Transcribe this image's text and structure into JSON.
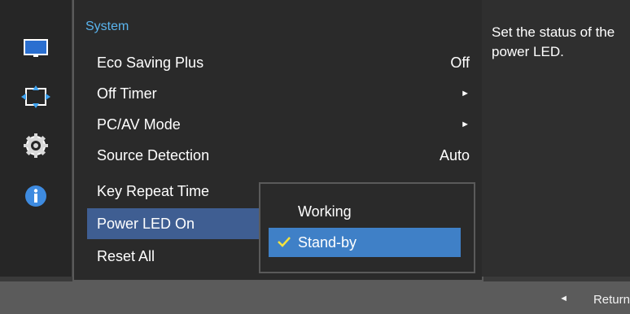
{
  "sidebar": {
    "icons": [
      "monitor-icon",
      "resize-arrows-icon",
      "gear-icon",
      "info-icon"
    ]
  },
  "menu": {
    "title": "System",
    "items": [
      {
        "label": "Eco Saving Plus",
        "value": "Off"
      },
      {
        "label": "Off Timer",
        "value": "►"
      },
      {
        "label": "PC/AV Mode",
        "value": "►"
      },
      {
        "label": "Source Detection",
        "value": "Auto"
      },
      {
        "label": "Key Repeat Time",
        "value": ""
      },
      {
        "label": "Power LED On",
        "value": ""
      },
      {
        "label": "Reset All",
        "value": ""
      }
    ]
  },
  "submenu": {
    "options": [
      {
        "label": "Working"
      },
      {
        "label": "Stand-by"
      }
    ]
  },
  "description": "Set the status of the power LED.",
  "footer": {
    "return_arrow": "◄",
    "return_label": "Return"
  },
  "colors": {
    "title_accent": "#5ab4ee",
    "selected_item": "#3f5e92",
    "active_option": "#3f80c7",
    "checkmark": "#f3e23f"
  }
}
